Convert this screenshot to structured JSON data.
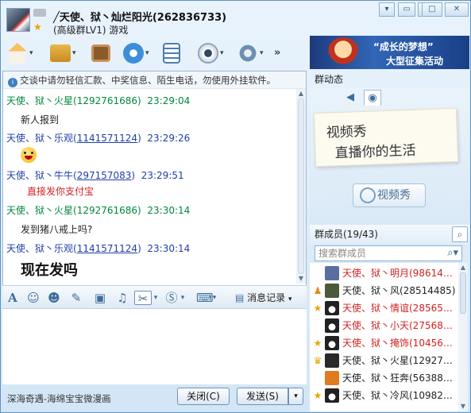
{
  "header": {
    "title": "╱天使、狱丶灿烂阳光(262836733)",
    "subtitle": "(高级群LV1) 游戏",
    "window_buttons": [
      "▾",
      "▭",
      "─",
      "□",
      "✕"
    ]
  },
  "toolbar": {
    "buttons": [
      "home-icon",
      "folder-icon",
      "album-icon",
      "voice-icon",
      "post-icon",
      "webcam-icon",
      "gear-icon"
    ],
    "more": "»"
  },
  "banner": {
    "line1": "“成长的梦想”",
    "line2": "大型征集活动"
  },
  "chat": {
    "notice": "交谈中请勿轻信汇款、中奖信息、陌生电话，勿使用外挂软件。",
    "messages": [
      {
        "sender": "天使、狱丶火星",
        "id": "(1292761686)",
        "time": "23:29:04",
        "text": "新人报到",
        "style": "green"
      },
      {
        "sender": "天使、狱丶乐观",
        "id": "1141571124",
        "time": "23:29:26",
        "text": "",
        "style": "blue",
        "emoji": true
      },
      {
        "sender": "天使、狱丶牛牛",
        "id": "297157083",
        "time": "23:29:51",
        "text": "直接发你支付宝",
        "style": "blue",
        "text_color": "red"
      },
      {
        "sender": "天使、狱丶火星",
        "id": "(1292761686)",
        "time": "23:30:14",
        "text": "发到猪八戒上吗?",
        "style": "green"
      },
      {
        "sender": "天使、狱丶乐观",
        "id": "1141571124",
        "time": "23:30:14",
        "text": "现在发吗",
        "style": "blue",
        "big": true
      }
    ]
  },
  "format_bar": {
    "history_label": "消息记录"
  },
  "bottom": {
    "ad_text": "深海奇遇-海绵宝宝微漫画",
    "close_label": "关闭(C)",
    "send_label": "发送(S)"
  },
  "side": {
    "group_news": "群动态",
    "video_line1": "视频秀",
    "video_line2": "直播你的生活",
    "video_button": "视频秀",
    "members_header": "群成员(19/43)",
    "member_search_placeholder": "搜索群成员",
    "members": [
      {
        "name": "天使、狱丶明月(9861435...",
        "color": "#d42020",
        "badge": "",
        "av": "#5a6fa0"
      },
      {
        "name": "天使、狱丶风(28514485)",
        "color": "#222",
        "badge": "person",
        "av": "#4a5a3a"
      },
      {
        "name": "天使、狱丶情谊(2856549...",
        "color": "#d42020",
        "badge": "star",
        "av": "penguin"
      },
      {
        "name": "天使、狱丶小天(2756875...",
        "color": "#d42020",
        "badge": "",
        "av": "penguin"
      },
      {
        "name": "天使、狱丶掩饰(1045612...",
        "color": "#d42020",
        "badge": "star",
        "av": "penguin"
      },
      {
        "name": "天使、狱丶火星(1292761...",
        "color": "#222",
        "badge": "crown",
        "av": "#2a2a2a"
      },
      {
        "name": "天使、狱丶狂奔(5638879...",
        "color": "#222",
        "badge": "",
        "av": "#e07b20"
      },
      {
        "name": "天使、狱丶冷风(1098235...",
        "color": "#222",
        "badge": "star",
        "av": "penguin"
      }
    ]
  },
  "colors": {
    "green": "#00883a",
    "blue": "#1f3fa8",
    "red": "#d42020",
    "border": "#5f93c0"
  }
}
